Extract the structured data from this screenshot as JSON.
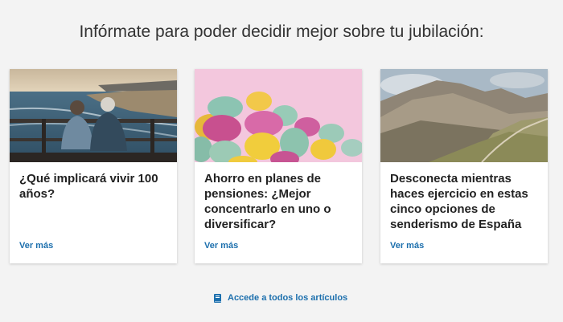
{
  "page": {
    "heading": "Infórmate para poder decidir mejor sobre tu jubilación:"
  },
  "cards": [
    {
      "image": "couple-on-pier-at-beach-photo",
      "title": "¿Qué implicará vivir 100 años?",
      "link": "Ver más"
    },
    {
      "image": "colored-easter-eggs-photo",
      "title": "Ahorro en planes de pensiones: ¿Mejor concentrarlo en uno o diversificar?",
      "link": "Ver más"
    },
    {
      "image": "mountain-hiking-trail-photo",
      "title": "Desconecta mientras haces ejercicio en estas cinco opciones de senderismo de España",
      "link": "Ver más"
    }
  ],
  "footer": {
    "all_articles_icon": "book-icon",
    "all_articles_label": "Accede a todos los artículos"
  },
  "colors": {
    "background": "#f3f3f3",
    "link": "#1c6fad",
    "title": "#222222"
  }
}
